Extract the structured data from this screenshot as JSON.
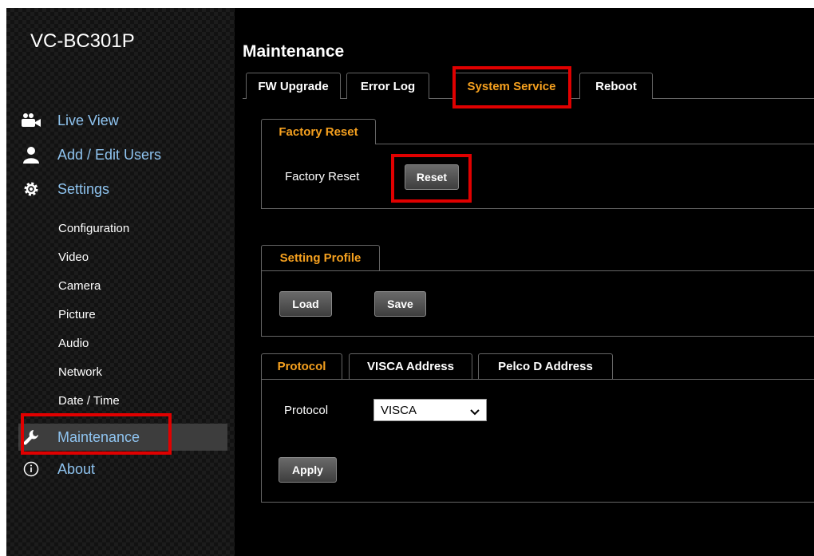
{
  "brand": "VC-BC301P",
  "nav": {
    "live_view": "Live View",
    "users": "Add / Edit Users",
    "settings": "Settings",
    "sub": [
      "Configuration",
      "Video",
      "Camera",
      "Picture",
      "Audio",
      "Network",
      "Date / Time"
    ],
    "maintenance": "Maintenance",
    "about": "About"
  },
  "page_title": "Maintenance",
  "tabs": [
    "FW Upgrade",
    "Error Log",
    "System Service",
    "Reboot"
  ],
  "active_tab": "System Service",
  "factory_reset": {
    "tab": "Factory Reset",
    "label": "Factory Reset",
    "button": "Reset"
  },
  "setting_profile": {
    "tab": "Setting Profile",
    "load": "Load",
    "save": "Save"
  },
  "protocol_panel": {
    "tabs": [
      "Protocol",
      "VISCA Address",
      "Pelco D Address"
    ],
    "label": "Protocol",
    "selected": "VISCA",
    "apply": "Apply"
  },
  "colors": {
    "accent_orange": "#f6a11f",
    "nav_blue": "#8fc4f0",
    "highlight_red": "#e00000"
  }
}
